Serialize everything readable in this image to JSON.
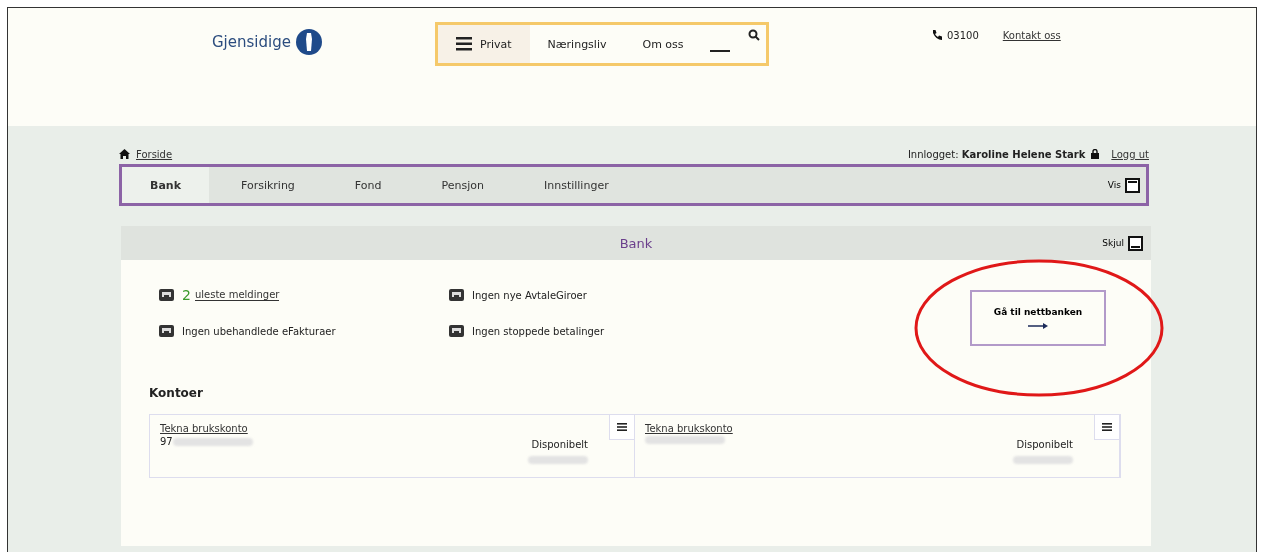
{
  "header": {
    "logo": "Gjensidige",
    "nav": [
      {
        "label": "Privat",
        "selected": true
      },
      {
        "label": "Næringsliv",
        "selected": false
      },
      {
        "label": "Om oss",
        "selected": false
      }
    ],
    "phone": "03100",
    "contact": "Kontakt oss"
  },
  "breadcrumb": "Forside",
  "login": {
    "label": "Innlogget:",
    "user": "Karoline Helene Stark",
    "logout": "Logg ut"
  },
  "tabs": [
    {
      "label": "Bank",
      "selected": true
    },
    {
      "label": "Forsikring",
      "selected": false
    },
    {
      "label": "Fond",
      "selected": false
    },
    {
      "label": "Pensjon",
      "selected": false
    },
    {
      "label": "Innstillinger",
      "selected": false
    }
  ],
  "view_toggle": "Vis",
  "panel": {
    "title": "Bank",
    "hide": "Skjul",
    "notices": [
      {
        "count": "2",
        "text": "uleste meldinger",
        "link": true
      },
      {
        "text": "Ingen nye AvtaleGiroer",
        "link": false
      },
      {
        "text": "Ingen ubehandlede eFakturaer",
        "link": false
      },
      {
        "text": "Ingen stoppede betalinger",
        "link": false
      }
    ],
    "netbank_button": "Gå til nettbanken",
    "accounts_title": "Kontoer",
    "accounts": [
      {
        "name": "Tekna brukskonto",
        "number": "97",
        "available": "Disponibelt"
      },
      {
        "name": "Tekna brukskonto",
        "available": "Disponibelt"
      }
    ]
  }
}
